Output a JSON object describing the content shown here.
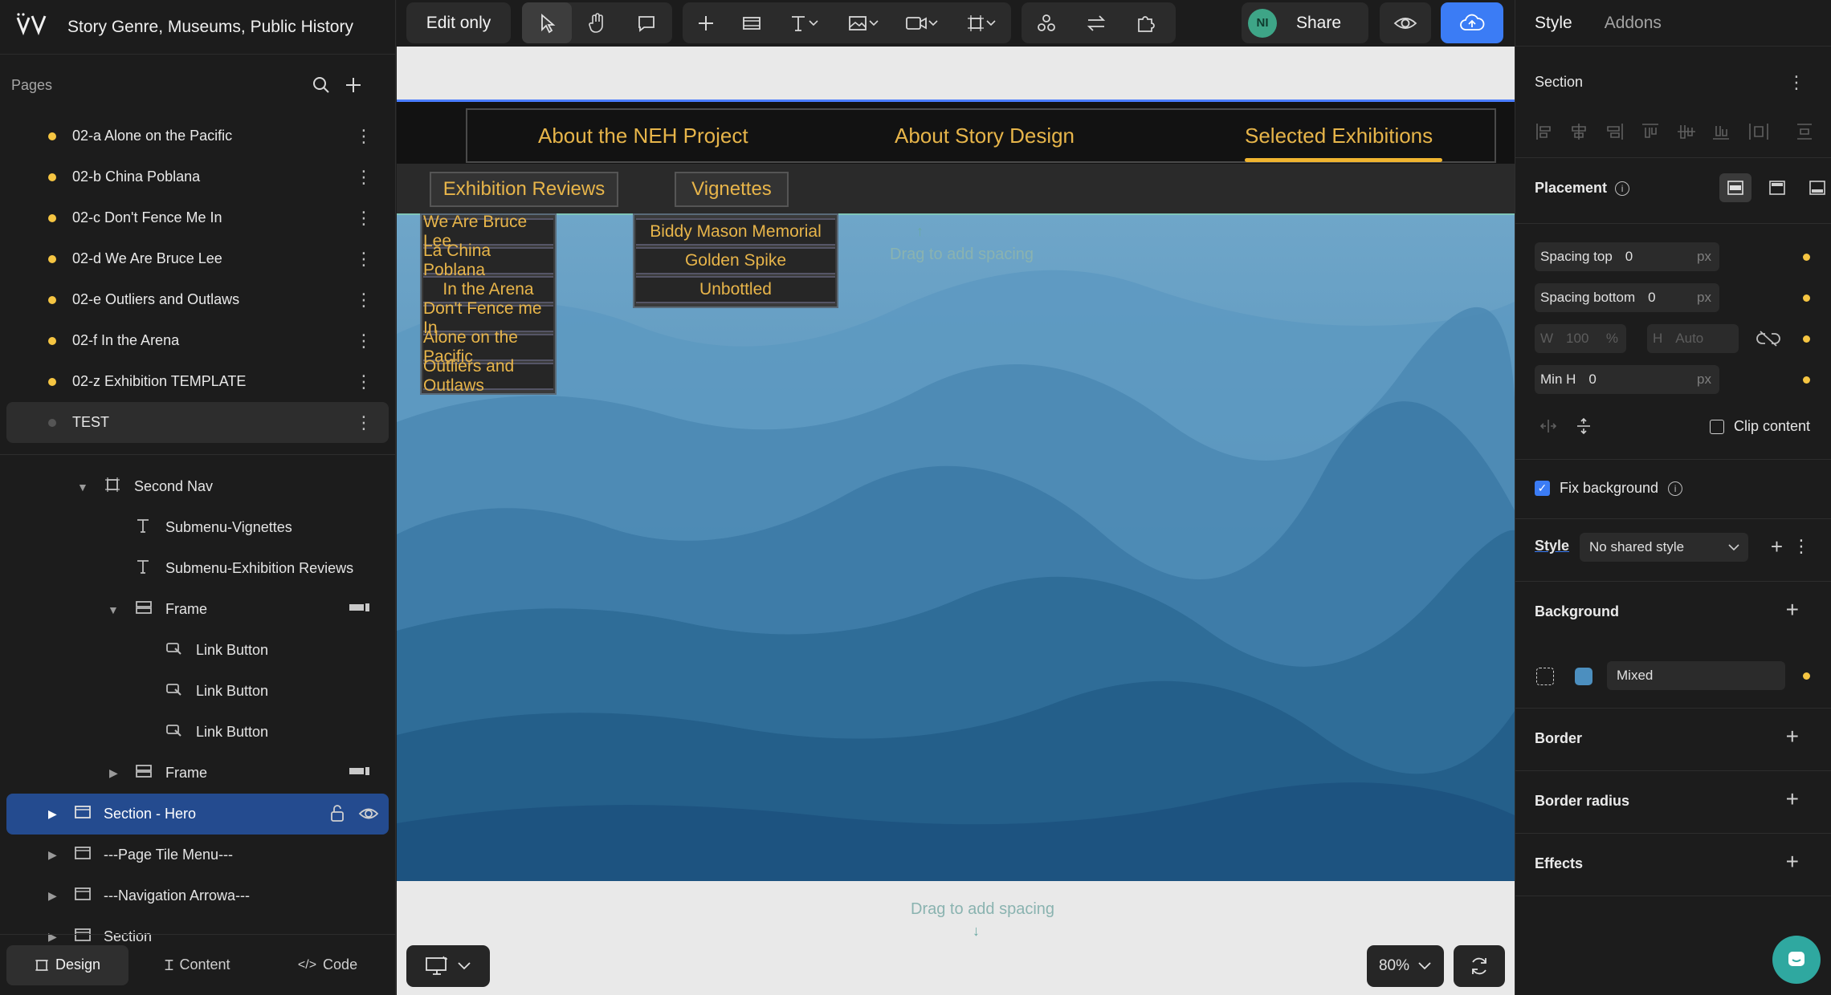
{
  "app": {
    "logo": "VV",
    "project_title": "Story Genre, Museums, Public History"
  },
  "pages_panel": {
    "label": "Pages",
    "pages": [
      {
        "name": "02-a Alone on the Pacific",
        "status": "yellow"
      },
      {
        "name": "02-b China Poblana",
        "status": "yellow"
      },
      {
        "name": "02-c Don't Fence Me In",
        "status": "yellow"
      },
      {
        "name": "02-d We Are Bruce Lee",
        "status": "yellow"
      },
      {
        "name": "02-e Outliers and Outlaws",
        "status": "yellow"
      },
      {
        "name": "02-f In the Arena",
        "status": "yellow"
      },
      {
        "name": "02-z Exhibition TEMPLATE",
        "status": "yellow"
      },
      {
        "name": "TEST",
        "status": "grey"
      }
    ]
  },
  "layers": [
    {
      "name": "Second Nav"
    },
    {
      "name": "Submenu-Vignettes"
    },
    {
      "name": "Submenu-Exhibition Reviews"
    },
    {
      "name": "Frame"
    },
    {
      "name": "Link Button"
    },
    {
      "name": "Link Button"
    },
    {
      "name": "Link Button"
    },
    {
      "name": "Frame"
    },
    {
      "name": "Section - Hero"
    },
    {
      "name": "---Page Tile Menu---"
    },
    {
      "name": "---Navigation Arrowa---"
    },
    {
      "name": "Section"
    }
  ],
  "footer_tabs": {
    "design": "Design",
    "content": "Content",
    "code": "Code"
  },
  "toolbar": {
    "mode_label": "Edit only",
    "avatar_initials": "NI",
    "share_label": "Share",
    "accent": "#3b7cf5"
  },
  "site": {
    "nav_links": [
      "About the NEH Project",
      "About Story Design",
      "Selected Exhibitions"
    ],
    "submenu_tabs": [
      "Exhibition Reviews",
      "Vignettes"
    ],
    "exhibition_reviews": [
      "We Are Bruce Lee",
      "La China Poblana",
      "In the Arena",
      "Don't Fence me In",
      "Alone on the Pacific",
      "Outliers and Outlaws"
    ],
    "vignettes": [
      "Biddy Mason Memorial",
      "Golden Spike",
      "Unbottled"
    ],
    "drag_hint_top": "Drag to add spacing",
    "drag_hint_bottom": "Drag to add spacing",
    "nav_text_color": "#e8b54a"
  },
  "canvas_controls": {
    "zoom": "80%"
  },
  "right_panel": {
    "tabs": [
      "Style",
      "Addons"
    ],
    "section_label": "Section",
    "placement_label": "Placement",
    "spacing_top": {
      "label": "Spacing top",
      "value": "0",
      "unit": "px"
    },
    "spacing_bottom": {
      "label": "Spacing bottom",
      "value": "0",
      "unit": "px"
    },
    "width": {
      "label": "W",
      "value": "100",
      "unit": "%"
    },
    "height": {
      "label": "H",
      "value": "Auto"
    },
    "min_h": {
      "label": "Min H",
      "value": "0",
      "unit": "px"
    },
    "clip_content": "Clip content",
    "fix_background": "Fix background",
    "fix_background_checked": true,
    "style_label": "Style",
    "style_value": "No shared style",
    "background_label": "Background",
    "background_value": "Mixed",
    "border_label": "Border",
    "border_radius_label": "Border radius",
    "effects_label": "Effects"
  }
}
